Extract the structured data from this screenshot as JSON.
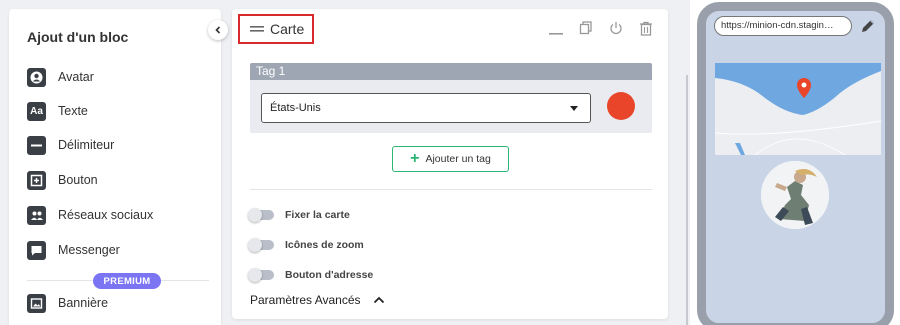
{
  "sidebar": {
    "title": "Ajout d'un bloc",
    "items": [
      {
        "label": "Avatar",
        "icon": "avatar-icon"
      },
      {
        "label": "Texte",
        "icon": "text-icon"
      },
      {
        "label": "Délimiteur",
        "icon": "divider-icon"
      },
      {
        "label": "Bouton",
        "icon": "button-icon"
      },
      {
        "label": "Réseaux sociaux",
        "icon": "social-networks-icon"
      },
      {
        "label": "Messenger",
        "icon": "messenger-icon"
      },
      {
        "label": "Bannière",
        "icon": "banner-icon"
      }
    ],
    "premium_label": "PREMIUM"
  },
  "panel": {
    "title": "Carte",
    "tag": {
      "header": "Tag 1",
      "country": "États-Unis",
      "color": "#e8452a"
    },
    "add_tag_label": "Ajouter un tag",
    "toggles": [
      {
        "label": "Fixer la carte",
        "on": false
      },
      {
        "label": "Icônes de zoom",
        "on": false
      },
      {
        "label": "Bouton d'adresse",
        "on": false
      }
    ],
    "advanced_label": "Paramètres Avancés"
  },
  "preview": {
    "url": "https://minion-cdn.stagin…"
  },
  "colors": {
    "highlight": "#d72a2a",
    "accent_green": "#2bb673",
    "premium": "#7b74f3",
    "phone_frame": "#9aa0ab",
    "map_water": "#6fa7e0",
    "marker": "#e8452a"
  }
}
